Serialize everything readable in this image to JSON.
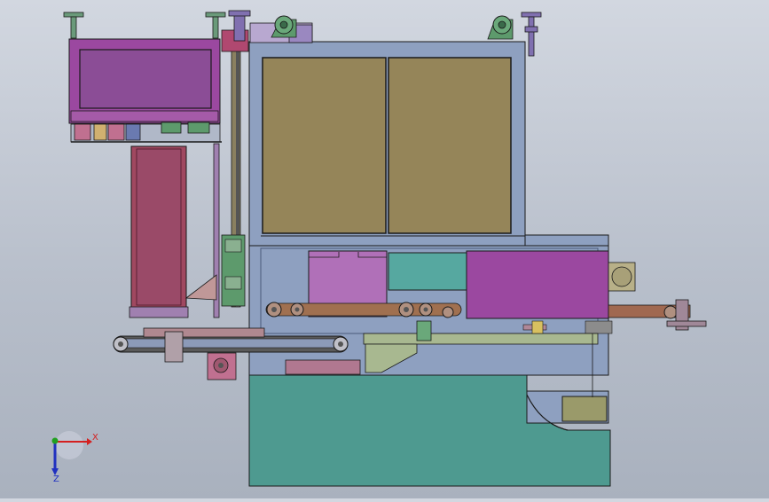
{
  "viewport": {
    "background_top": "#d2d7e0",
    "background_bottom": "#a9b1be"
  },
  "colors": {
    "frame": "#8ea0c0",
    "frame_dark": "#6e7fa0",
    "panel_olive": "#958559",
    "cabinet_teal": "#4e9a90",
    "teal_block": "#56a8a0",
    "magenta": "#9b48a0",
    "magenta_light": "#b070b8",
    "purple_box": "#8b4d96",
    "maroon": "#a04860",
    "green_part": "#5d9a6c",
    "outline": "#1a1a1a"
  },
  "triad": {
    "x_label": "X",
    "z_label": "Z",
    "x_color": "#d42020",
    "y_color": "#20a020",
    "z_color": "#2030c0"
  }
}
